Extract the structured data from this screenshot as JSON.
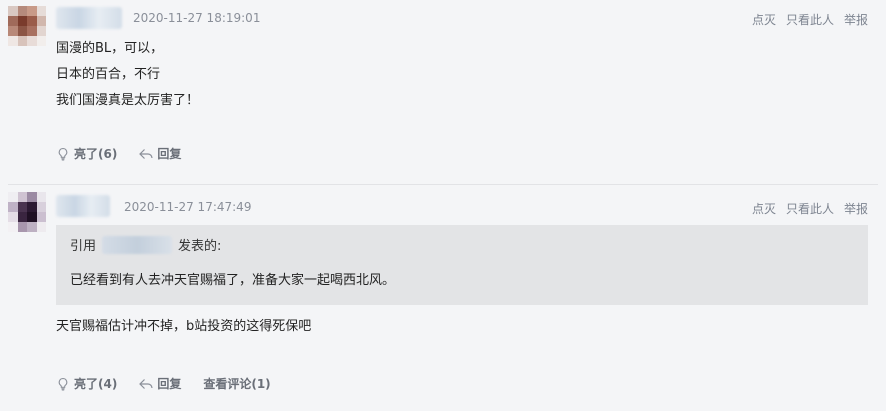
{
  "colors": {
    "background": "#f4f5f7",
    "quote_bg": "#e3e4e6",
    "meta_text": "#8a8f99"
  },
  "comments": [
    {
      "time": "2020-11-27 18:19:01",
      "ops": [
        "点灭",
        "只看此人",
        "举报"
      ],
      "lines": [
        "国漫的BL，可以，",
        "日本的百合，不行",
        "我们国漫真是太厉害了！"
      ],
      "like_label": "亮了(6)",
      "reply_label": "回复"
    },
    {
      "time": "2020-11-27 17:47:49",
      "ops": [
        "点灭",
        "只看此人",
        "举报"
      ],
      "quote_prefix": "引用",
      "quote_suffix": "发表的:",
      "quote_text": "已经看到有人去冲天官赐福了，准备大家一起喝西北风。",
      "body": "天官赐福估计冲不掉，b站投资的这得死保吧",
      "like_label": "亮了(4)",
      "reply_label": "回复",
      "view_comments_label": "查看评论(1)"
    }
  ]
}
